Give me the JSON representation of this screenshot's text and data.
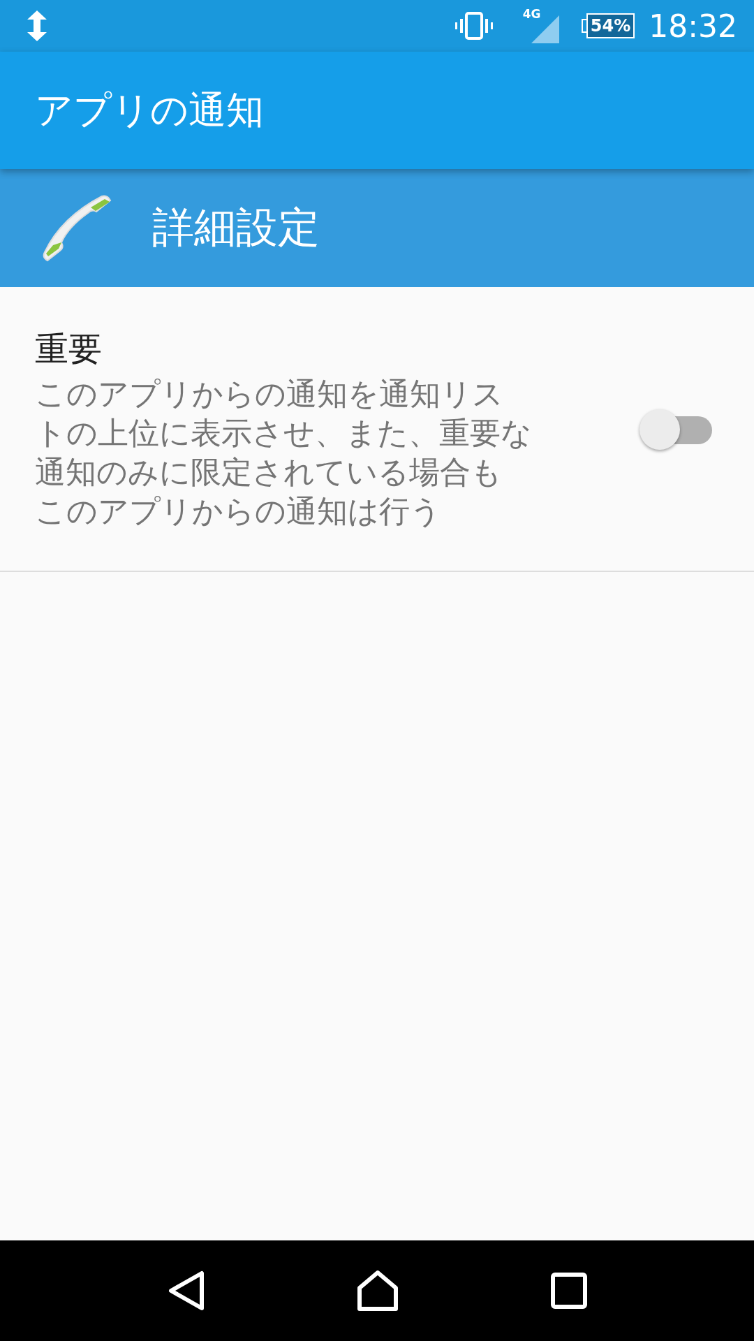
{
  "status_bar": {
    "network": "4G",
    "battery": "54%",
    "time": "18:32"
  },
  "app_bar": {
    "title": "アプリの通知"
  },
  "header": {
    "title": "詳細設定"
  },
  "settings": [
    {
      "title": "重要",
      "description": "このアプリからの通知を通知リストの上位に表示させ、また、重要な通知のみに限定されている場合もこのアプリからの通知は行う",
      "on": false
    }
  ]
}
